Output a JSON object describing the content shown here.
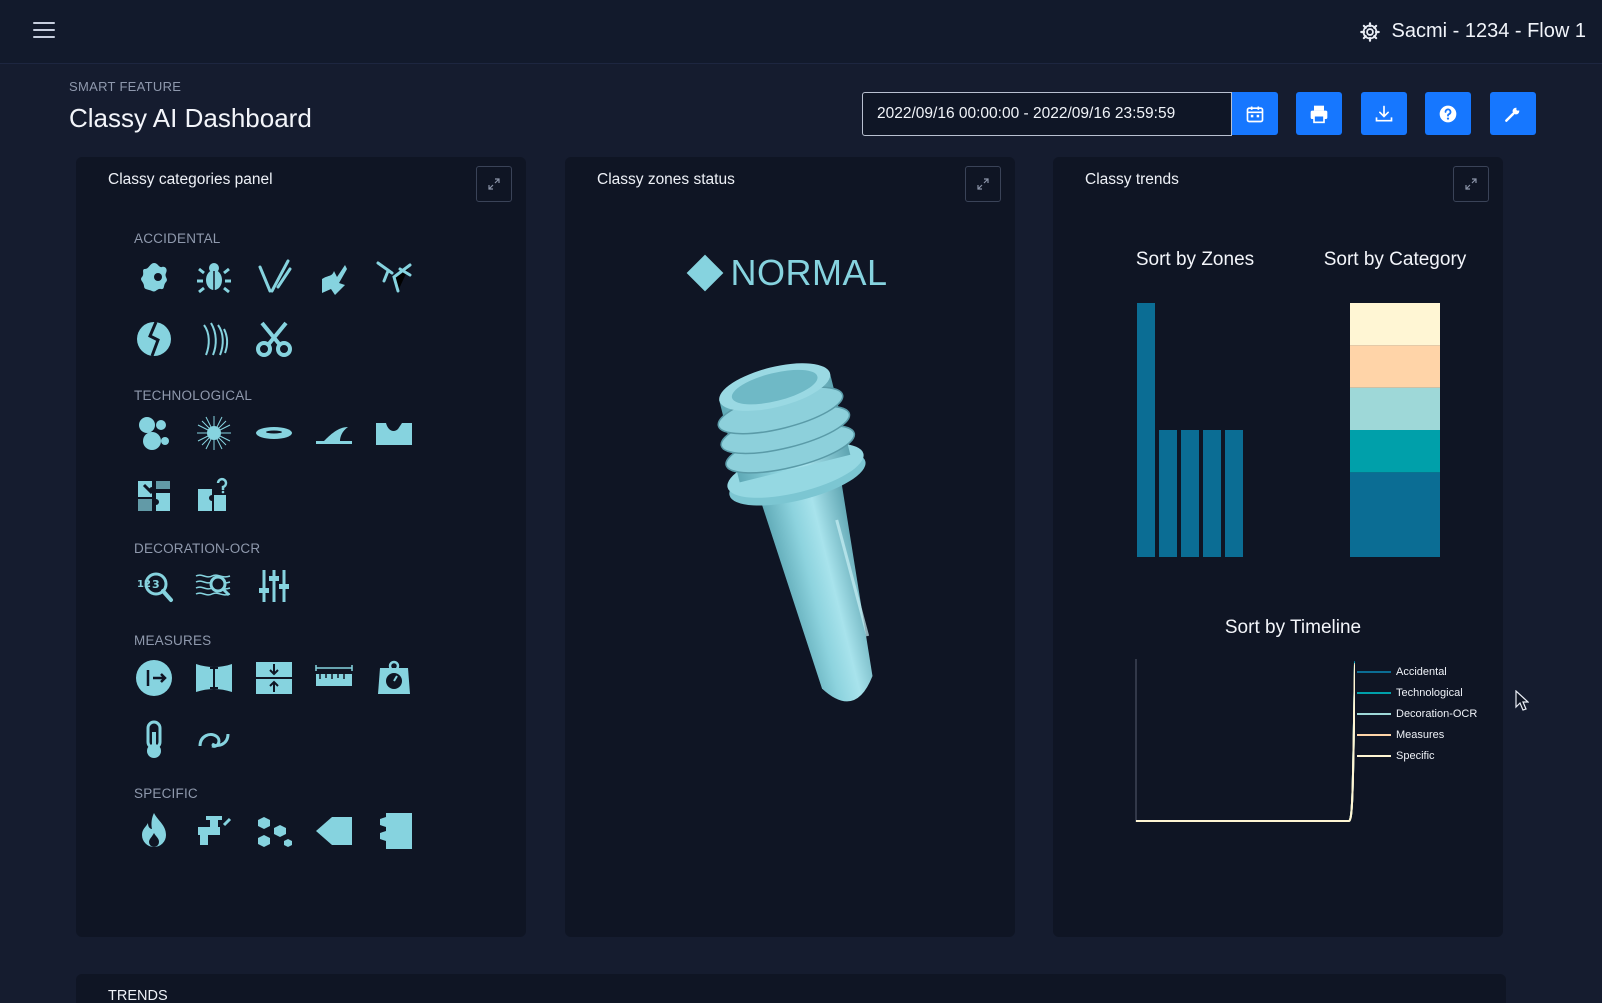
{
  "header": {
    "flow_title": "Sacmi - 1234 - Flow 1",
    "menu_icon": "hamburger-menu-icon",
    "settings_icon": "gear-icon"
  },
  "page": {
    "eyebrow": "SMART FEATURE",
    "title": "Classy AI Dashboard"
  },
  "toolbar": {
    "date_range": "2022/09/16 00:00:00 - 2022/09/16 23:59:59",
    "buttons": [
      "calendar-icon",
      "print-icon",
      "download-icon",
      "help-icon",
      "wrench-icon"
    ],
    "accent_color": "#1677ff"
  },
  "panels": {
    "categories": {
      "title": "Classy categories panel",
      "groups": [
        {
          "label": "ACCIDENTAL",
          "icons": [
            "splat-icon",
            "bug-icon",
            "scratch-icon",
            "crack-icon",
            "break-icon",
            "leaf-icon",
            "streak-icon",
            "scissors-icon"
          ]
        },
        {
          "label": "TECHNOLOGICAL",
          "icons": [
            "bubbles-icon",
            "burst-icon",
            "ellipse-icon",
            "fin-icon",
            "notch-icon",
            "puzzle-icon",
            "puzzle-question-icon"
          ]
        },
        {
          "label": "DECORATION-OCR",
          "icons": [
            "ocr-magnify-icon",
            "pattern-magnify-icon",
            "sliders-icon"
          ]
        },
        {
          "label": "MEASURES",
          "icons": [
            "gauge-icon",
            "height-icon",
            "gap-icon",
            "ruler-icon",
            "weight-icon",
            "thermometer-icon",
            "ovality-icon"
          ]
        },
        {
          "label": "SPECIFIC",
          "icons": [
            "flame-icon",
            "tap-icon",
            "granules-icon",
            "cap-icon",
            "neck-icon"
          ]
        }
      ]
    },
    "zones": {
      "title": "Classy zones status",
      "status": "NORMAL",
      "status_color": "#86d3df"
    },
    "trends": {
      "title": "Classy trends"
    }
  },
  "chart_data": [
    {
      "type": "bar",
      "title": "Sort by Zones",
      "categories": [
        "",
        "",
        "",
        "",
        ""
      ],
      "values": [
        2,
        1,
        1,
        1,
        1
      ],
      "ylim": [
        0,
        2
      ],
      "color": "#0b6d94"
    },
    {
      "type": "bar",
      "title": "Sort by Category",
      "stacked": true,
      "series": [
        {
          "value": 2,
          "color": "#0b6d94"
        },
        {
          "value": 1,
          "color": "#00a0aa"
        },
        {
          "value": 1,
          "color": "#9ed8d8"
        },
        {
          "value": 1,
          "color": "#ffd4a8"
        },
        {
          "value": 1,
          "color": "#fff6d4"
        }
      ]
    },
    {
      "type": "line",
      "title": "Sort by Timeline",
      "series": [
        {
          "name": "Accidental",
          "color": "#0b6d94"
        },
        {
          "name": "Technological",
          "color": "#00a0aa"
        },
        {
          "name": "Decoration-OCR",
          "color": "#9ed8d8"
        },
        {
          "name": "Measures",
          "color": "#ffd4a8"
        },
        {
          "name": "Specific",
          "color": "#fff6d4"
        }
      ],
      "legend": "right"
    }
  ],
  "bottom": {
    "trends_label": "TRENDS"
  }
}
